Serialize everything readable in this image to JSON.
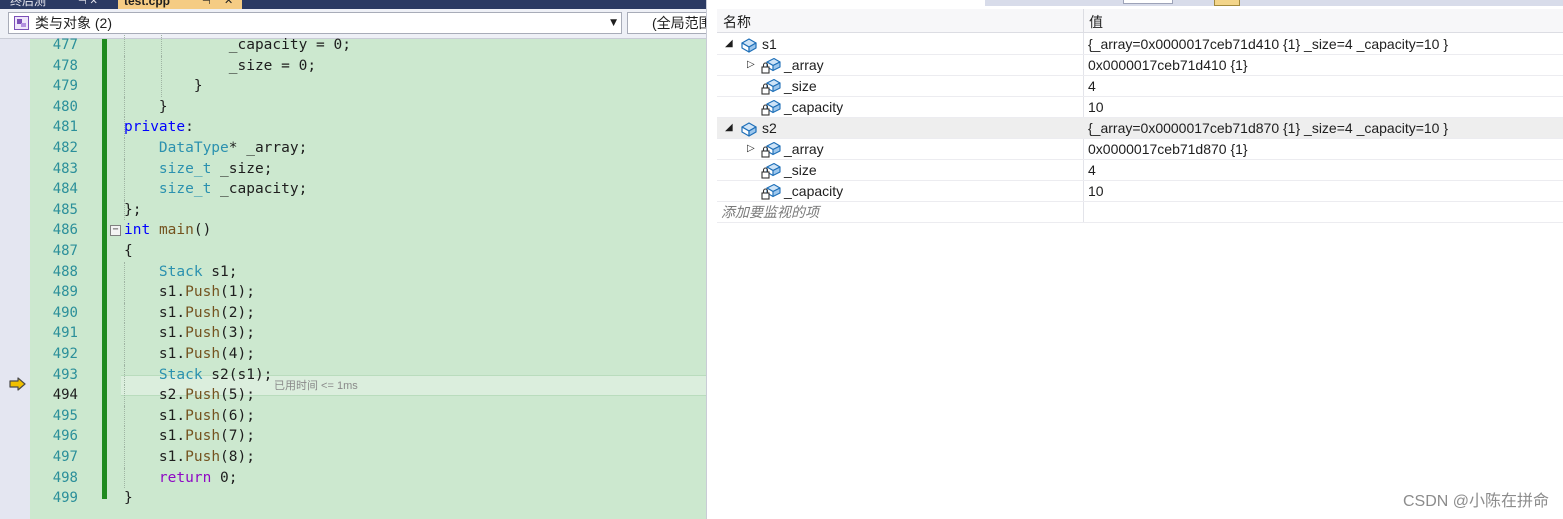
{
  "tabs": {
    "prev_label": "终后测",
    "prev_pin": "⊣ ✕",
    "active_label": "test.cpp",
    "active_pin": "⊣",
    "active_close": "✕"
  },
  "navbar": {
    "scope_label": "类与对象 (2)",
    "global_label": "(全局范围)"
  },
  "code": {
    "lines": [
      {
        "n": "477",
        "text": "            _capacity = 0;"
      },
      {
        "n": "478",
        "text": "            _size = 0;"
      },
      {
        "n": "479",
        "text": "        }"
      },
      {
        "n": "480",
        "text": "    }"
      },
      {
        "n": "481",
        "kw": "private",
        "rest": ":"
      },
      {
        "n": "482",
        "ty": "DataType",
        "rest": "* _array;"
      },
      {
        "n": "483",
        "ty": "size_t",
        "rest": " _size;"
      },
      {
        "n": "484",
        "ty": "size_t",
        "rest": " _capacity;"
      },
      {
        "n": "485",
        "text": "};"
      },
      {
        "n": "486",
        "kw": "int",
        "fn": "main",
        "rest": "()"
      },
      {
        "n": "487",
        "text": "{"
      },
      {
        "n": "488",
        "ty": "Stack",
        "rest": " s1;"
      },
      {
        "n": "489",
        "obj": "s1",
        "fn": "Push",
        "rest": "(1);"
      },
      {
        "n": "490",
        "obj": "s1",
        "fn": "Push",
        "rest": "(2);"
      },
      {
        "n": "491",
        "obj": "s1",
        "fn": "Push",
        "rest": "(3);"
      },
      {
        "n": "492",
        "obj": "s1",
        "fn": "Push",
        "rest": "(4);"
      },
      {
        "n": "493",
        "ty": "Stack",
        "rest": " s2(s1);"
      },
      {
        "n": "494",
        "obj": "s2",
        "fn": "Push",
        "rest": "(5);"
      },
      {
        "n": "495",
        "obj": "s1",
        "fn": "Push",
        "rest": "(6);"
      },
      {
        "n": "496",
        "obj": "s1",
        "fn": "Push",
        "rest": "(7);"
      },
      {
        "n": "497",
        "obj": "s1",
        "fn": "Push",
        "rest": "(8);"
      },
      {
        "n": "498",
        "kw2": "return",
        "rest": " 0;"
      },
      {
        "n": "499",
        "text": "}"
      }
    ],
    "current_line": "494",
    "elapsed_hint": "已用时间 <= 1ms",
    "fold_glyph": "−"
  },
  "watch": {
    "header_name": "名称",
    "header_value": "值",
    "rows": [
      {
        "name": "s1",
        "value": "{_array=0x0000017ceb71d410 {1} _size=4 _capacity=10 }",
        "expander": "◢",
        "icon": "object-icon"
      },
      {
        "name": "_array",
        "value": "0x0000017ceb71d410 {1}",
        "expander": "▷",
        "icon": "private-field-icon"
      },
      {
        "name": "_size",
        "value": "4",
        "expander": "",
        "icon": "private-field-icon"
      },
      {
        "name": "_capacity",
        "value": "10",
        "expander": "",
        "icon": "private-field-icon"
      },
      {
        "name": "s2",
        "value": "{_array=0x0000017ceb71d870 {1} _size=4 _capacity=10 }",
        "expander": "◢",
        "icon": "object-icon"
      },
      {
        "name": "_array",
        "value": "0x0000017ceb71d870 {1}",
        "expander": "▷",
        "icon": "private-field-icon"
      },
      {
        "name": "_size",
        "value": "4",
        "expander": "",
        "icon": "private-field-icon"
      },
      {
        "name": "_capacity",
        "value": "10",
        "expander": "",
        "icon": "private-field-icon"
      }
    ],
    "add_watch_placeholder": "添加要监视的项"
  },
  "watermark": "CSDN @⁢⁢小陈在拼命⁢⁢",
  "colors": {
    "editor_bg": "#cce8cf",
    "keyword": "#0000ff",
    "control_keyword": "#8f08c4",
    "type": "#2b91af",
    "function": "#74531f",
    "line_number": "#2b8f9a",
    "change_bar": "#1f8a1f",
    "active_tab": "#f5cc84",
    "tab_bar": "#2b3a63",
    "exec_arrow": "#f0c000"
  }
}
